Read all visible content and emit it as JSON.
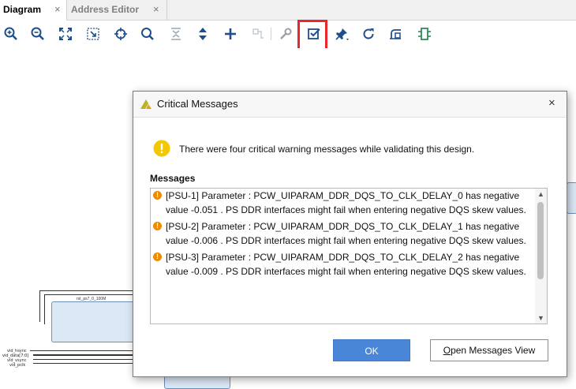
{
  "tabs": [
    {
      "label": "Diagram",
      "close": "×"
    },
    {
      "label": "Address Editor",
      "close": "×"
    }
  ],
  "toolbar": {
    "icons": [
      "zoom-in",
      "zoom-out",
      "zoom-fit",
      "zoom-area",
      "center",
      "search",
      "collapse-all",
      "expand-all",
      "add",
      "make-connection",
      "properties",
      "validate-design",
      "pin",
      "regenerate-layout",
      "optimize-routing",
      "add-module"
    ],
    "highlight_color": "#e8262b"
  },
  "canvas": {
    "block_label": "rst_ps7_0_100M",
    "port_labels": [
      "vid_hsync",
      "vid_data[7:0]",
      "vid_vsync",
      "vid_pclk"
    ]
  },
  "dialog": {
    "title": "Critical Messages",
    "close": "×",
    "summary": "There were four critical warning messages while validating this design.",
    "messages_heading": "Messages",
    "messages": [
      {
        "text": "[PSU-1]  Parameter : PCW_UIPARAM_DDR_DQS_TO_CLK_DELAY_0 has negative value -0.051 . PS DDR interfaces might fail when entering negative DQS skew values."
      },
      {
        "text": "[PSU-2]  Parameter : PCW_UIPARAM_DDR_DQS_TO_CLK_DELAY_1 has negative value -0.006 . PS DDR interfaces might fail when entering negative DQS skew values."
      },
      {
        "text": "[PSU-3]  Parameter : PCW_UIPARAM_DDR_DQS_TO_CLK_DELAY_2 has negative value -0.009 . PS DDR interfaces might fail when entering negative DQS skew values."
      }
    ],
    "ok_label": "OK",
    "view_label_underlined": "O",
    "view_label_rest": "pen Messages View",
    "accent": "#4a86d8"
  }
}
